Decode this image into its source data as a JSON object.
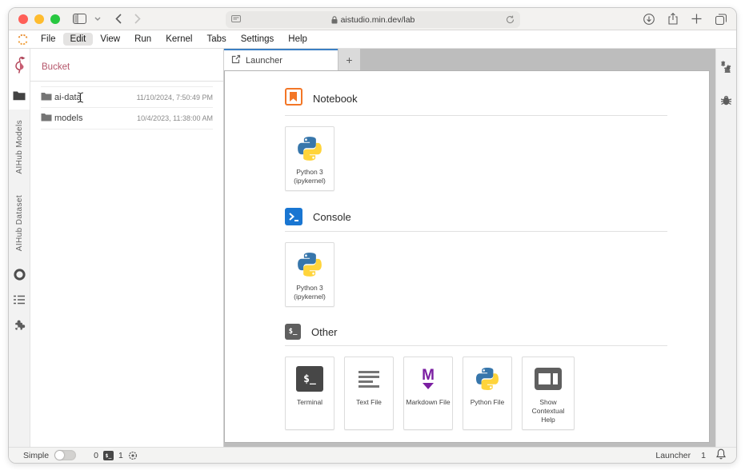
{
  "browser": {
    "url": "aistudio.min.dev/lab",
    "new_tab_glyph": "+"
  },
  "menubar": {
    "items": [
      "File",
      "Edit",
      "View",
      "Run",
      "Kernel",
      "Tabs",
      "Settings",
      "Help"
    ],
    "active_item": "Edit"
  },
  "left_dock": {
    "tab_labels": [
      "AIHub Models",
      "AIHub Dataset"
    ]
  },
  "file_browser": {
    "title": "Bucket",
    "rows": [
      {
        "name": "ai-data",
        "modified": "11/10/2024, 7:50:49 PM"
      },
      {
        "name": "models",
        "modified": "10/4/2023, 11:38:00 AM"
      }
    ]
  },
  "main": {
    "tab_label": "Launcher",
    "add_tab_glyph": "+",
    "sections": [
      {
        "title": "Notebook",
        "cards": [
          {
            "label": "Python 3",
            "sublabel": "(ipykernel)"
          }
        ]
      },
      {
        "title": "Console",
        "cards": [
          {
            "label": "Python 3",
            "sublabel": "(ipykernel)"
          }
        ]
      },
      {
        "title": "Other",
        "cards": [
          {
            "label": "Terminal"
          },
          {
            "label": "Text File"
          },
          {
            "label": "Markdown File"
          },
          {
            "label": "Python File"
          },
          {
            "label": "Show",
            "sublabel": "Contextual Help"
          }
        ]
      }
    ]
  },
  "icons": {
    "terminal_glyph": "$_",
    "markdown_glyph": "M",
    "gears_glyph": "⚙"
  },
  "statusbar": {
    "mode_label": "Simple",
    "terminals_count": "0",
    "kernels_count": "1",
    "context_label": "Launcher",
    "notifications_count": "1"
  },
  "colors": {
    "tab_accent_blue": "#3b7fc4",
    "bucket_red": "#b5566a",
    "jupyter_orange": "#f37626",
    "console_blue": "#1976d2",
    "markdown_purple": "#7b1fa2",
    "python_blue": "#3776ab",
    "python_yellow": "#ffd43b",
    "traffic_red": "#ff5f57",
    "traffic_yellow": "#febc2e",
    "traffic_green": "#28c840"
  }
}
